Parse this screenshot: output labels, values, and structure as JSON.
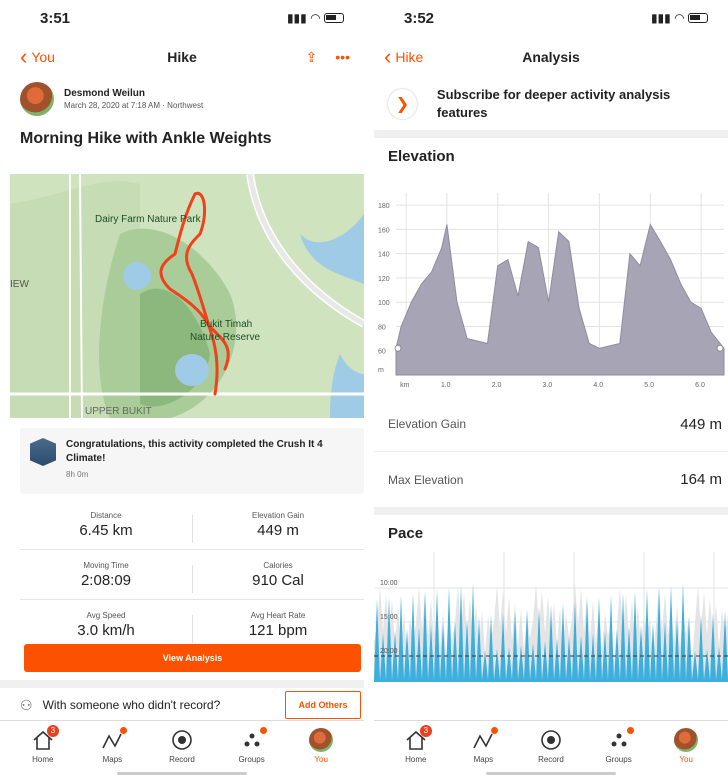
{
  "left": {
    "status_time": "3:51",
    "nav": {
      "back_label": "You",
      "title": "Hike"
    },
    "athlete": {
      "name": "Desmond Weilun",
      "meta": "March 28, 2020 at 7:18 AM · Northwest"
    },
    "activity_title": "Morning Hike with Ankle Weights",
    "map": {
      "labels": [
        "Dairy Farm Nature Park",
        "Bukit Timah",
        "Nature Reserve",
        "IEW",
        "UPPER BUKIT"
      ]
    },
    "challenge": {
      "text": "Congratulations, this activity completed the Crush It 4 Climate!",
      "time": "8h 0m"
    },
    "stats": [
      [
        {
          "label": "Distance",
          "value": "6.45 km"
        },
        {
          "label": "Elevation Gain",
          "value": "449 m"
        }
      ],
      [
        {
          "label": "Moving Time",
          "value": "2:08:09"
        },
        {
          "label": "Calories",
          "value": "910 Cal"
        }
      ],
      [
        {
          "label": "Avg Speed",
          "value": "3.0 km/h"
        },
        {
          "label": "Avg Heart Rate",
          "value": "121 bpm"
        }
      ]
    ],
    "view_analysis": "View Analysis",
    "invite": {
      "text": "With someone who didn't record?",
      "button": "Add Others"
    }
  },
  "right": {
    "status_time": "3:52",
    "nav": {
      "back_label": "Hike",
      "title": "Analysis"
    },
    "subscribe": "Subscribe for deeper activity analysis features",
    "elevation": {
      "title": "Elevation",
      "gain_label": "Elevation Gain",
      "gain_value": "449 m",
      "max_label": "Max Elevation",
      "max_value": "164 m"
    },
    "pace": {
      "title": "Pace"
    }
  },
  "tabs": [
    {
      "label": "Home",
      "icon": "home-icon",
      "badge": "3"
    },
    {
      "label": "Maps",
      "icon": "maps-icon",
      "dot": true
    },
    {
      "label": "Record",
      "icon": "record-icon"
    },
    {
      "label": "Groups",
      "icon": "groups-icon",
      "dot": true
    },
    {
      "label": "You",
      "icon": "avatar-icon",
      "active": true
    }
  ],
  "colors": {
    "accent": "#fc5200",
    "elevation_fill": "#a7a4b5",
    "pace_fill": "#2aa8dc",
    "map_route": "#f0401c"
  },
  "chart_data": [
    {
      "type": "area",
      "title": "Elevation",
      "xlabel": "",
      "ylabel": "",
      "x_ticks": [
        "km",
        "1.0",
        "2.0",
        "3.0",
        "4.0",
        "5.0",
        "6.0"
      ],
      "y_ticks": [
        "180",
        "160",
        "140",
        "120",
        "100",
        "80",
        "60",
        "m"
      ],
      "ylim": [
        40,
        190
      ],
      "xlim": [
        0,
        6.45
      ],
      "grid": true,
      "x": [
        0,
        0.1,
        0.3,
        0.5,
        0.7,
        0.9,
        1.0,
        1.2,
        1.4,
        1.6,
        1.8,
        2.0,
        2.2,
        2.4,
        2.6,
        2.8,
        3.0,
        3.2,
        3.4,
        3.6,
        3.8,
        4.0,
        4.2,
        4.4,
        4.6,
        4.8,
        5.0,
        5.2,
        5.4,
        5.6,
        5.8,
        6.0,
        6.2,
        6.45
      ],
      "values": [
        62,
        80,
        100,
        115,
        125,
        145,
        164,
        100,
        70,
        68,
        66,
        130,
        135,
        105,
        150,
        145,
        100,
        158,
        150,
        95,
        66,
        62,
        64,
        66,
        140,
        130,
        164,
        150,
        135,
        115,
        100,
        95,
        75,
        62
      ]
    },
    {
      "type": "area",
      "title": "Pace",
      "y_ticks": [
        "10:00",
        "15:00",
        "20:00"
      ],
      "grid": true
    }
  ]
}
